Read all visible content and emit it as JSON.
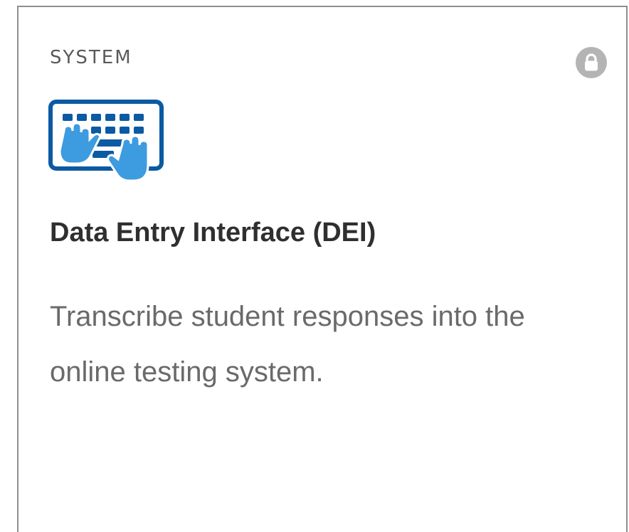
{
  "card": {
    "category": "SYSTEM",
    "title": "Data Entry Interface (DEI)",
    "description": "Transcribe student responses into the online testing system.",
    "status_icon": "lock-icon",
    "app_icon": "keyboard-hands-icon",
    "colors": {
      "icon_dark_blue": "#0b5aa3",
      "icon_light_blue": "#3d9be0",
      "lock_gray": "#b4b4b4"
    }
  }
}
